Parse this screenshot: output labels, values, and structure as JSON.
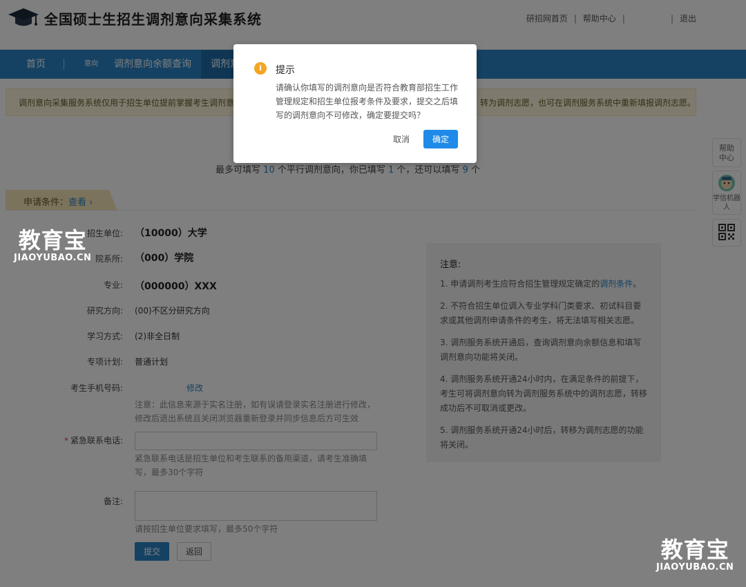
{
  "header": {
    "title": "全国硕士生招生调剂意向采集系统",
    "links": [
      "研招网首页",
      "帮助中心",
      "退出"
    ],
    "separator": "|"
  },
  "nav": {
    "items": [
      "首页",
      "意向",
      "调剂意向余额查询",
      "调剂意"
    ]
  },
  "banner": {
    "left_text": "调剂意向采集服务系统仅用于招生单位提前掌握考生调剂意",
    "right_text": "转为调剂志愿，也可在调剂服务系统中重新填报调剂志愿。"
  },
  "count": {
    "prefix": "最多可填写",
    "max": "10",
    "mid1": "个平行调剂意向，你已填写",
    "filled": "1",
    "mid2": "个，还可以填写",
    "remaining": "9",
    "suffix": "个"
  },
  "sidebar": {
    "help": "帮助中心",
    "robot": "学信机器人",
    "qr_icon": "qr-code-icon"
  },
  "conditions_tab": {
    "label": "申请条件：",
    "link": "查看 ›"
  },
  "form": {
    "unit_label": "招生单位:",
    "unit_value": "（10000）大学",
    "dept_label": "院系所:",
    "dept_value": "（000）学院",
    "major_label": "专业:",
    "major_value": "（000000）XXX",
    "direction_label": "研究方向:",
    "direction_value": "(00)不区分研究方向",
    "mode_label": "学习方式:",
    "mode_value": "(2)非全日制",
    "plan_label": "专项计划:",
    "plan_value": "普通计划",
    "phone_label": "考生手机号码:",
    "phone_edit": "修改",
    "phone_hint": "注意：此信息来源于实名注册，如有误请登录实名注册进行修改，修改后退出系统且关闭浏览器重新登录并同步信息后方可生效",
    "emergency_required": "*",
    "emergency_label": "紧急联系电话:",
    "emergency_value": "",
    "emergency_hint": "紧急联系电话是招生单位和考生联系的备用渠道，请考生准确填写，最多30个字符",
    "remark_label": "备注:",
    "remark_value": "",
    "remark_hint": "请按招生单位要求填写，最多50个字符",
    "submit": "提交",
    "back": "返回"
  },
  "notes": {
    "title": "注意:",
    "items": [
      {
        "text": "1. 申请调剂考生应符合招生管理规定确定的",
        "link": "调剂条件",
        "tail": "。"
      },
      {
        "text": "2. 不符合招生单位调入专业学科门类要求、初试科目要求或其他调剂申请条件的考生，将无法填写相关志愿。",
        "link": "",
        "tail": ""
      },
      {
        "text": "3. 调剂服务系统开通后，查询调剂意向余额信息和填写调剂意向功能将关闭。",
        "link": "",
        "tail": ""
      },
      {
        "text": "4. 调剂服务系统开通24小时内，在满足条件的前提下，考生可将调剂意向转为调剂服务系统中的调剂志愿，转移成功后不可取消或更改。",
        "link": "",
        "tail": ""
      },
      {
        "text": "5. 调剂服务系统开通24小时后，转移为调剂志愿的功能将关闭。",
        "link": "",
        "tail": ""
      }
    ]
  },
  "watermark": {
    "cn": "教育宝",
    "en": "JIAOYUBAO.CN"
  },
  "dialog": {
    "icon_text": "i",
    "title": "提示",
    "message": "请确认你填写的调剂意向是否符合教育部招生工作管理规定和招生单位报考条件及要求，提交之后填写的调剂意向不可修改，确定要提交吗？",
    "cancel": "取消",
    "ok": "确定"
  }
}
